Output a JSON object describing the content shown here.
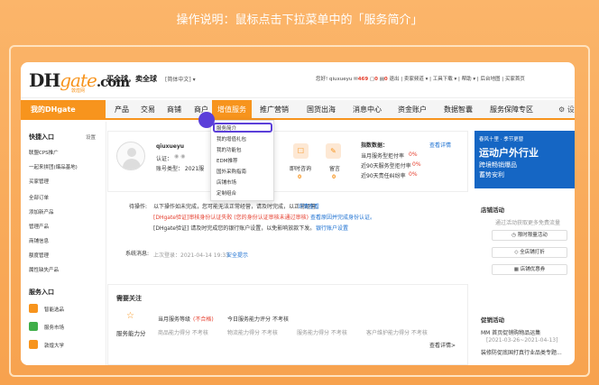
{
  "instruction": "操作说明：鼠标点击下拉菜单中的「服务简介」",
  "header": {
    "logo_dh": "DH",
    "logo_g": "gate",
    ".com": "",
    "logo_com": ".com",
    "logo_sub": "敦煌网",
    "slogan": "买全球，卖全球",
    "lang": "[简体中文] ▾",
    "hello": "您好! qiuxueyu",
    "msg_count": "469",
    "msg2": "0",
    "msg3": "0",
    "links": [
      "退出",
      "卖家频道 ▾",
      "工具下载 ▾",
      "帮助 ▾",
      "后台地图",
      "买家首页"
    ]
  },
  "nav": {
    "mine": "我的DHgate",
    "items": [
      "产品",
      "交易",
      "商铺",
      "商户",
      "增值服务",
      "推广营销",
      "国货出海",
      "消息中心",
      "资金账户",
      "数据智囊",
      "服务保障专区"
    ],
    "gear": "⚙ 设"
  },
  "sidebar": {
    "quick_title": "快捷入口",
    "set": "设置",
    "quick_items": [
      "联盟CPS推广",
      "一起来拼团(爆品基地)",
      "买家管理",
      "全部订单",
      "添加新产品",
      "管理产品",
      "商铺信息",
      "额度管理",
      "属性缺失产品"
    ],
    "service_title": "服务入口",
    "service_items": [
      "智能选品",
      "服务市场",
      "敦煌大学"
    ]
  },
  "dropdown": [
    "服务简介",
    "我的增值礼包",
    "我的功能包",
    "EDM推荐",
    "国外采购指南",
    "店铺市场",
    "定制组合"
  ],
  "profile": {
    "name": "qiuxueyu",
    "auth": "认证：",
    "acct": "账号类型：  2021服",
    "stats": [
      {
        "label": "即时咨询",
        "value": "0"
      },
      {
        "label": "留言",
        "value": "0"
      }
    ]
  },
  "indicators": {
    "title": "指数数据：",
    "more": "查看详情",
    "rows": [
      {
        "label": "当月服务型拒付率",
        "value": "0%"
      },
      {
        "label": "近90天服务型拒付率",
        "value": "0%"
      },
      {
        "label": "近90天责任纠纷率",
        "value": "0%"
      }
    ]
  },
  "tasks": {
    "label": "待操作:",
    "line1": "以下操作如未完成，您可能无法正常经营，请及时完成，以正常经营,",
    "line1_link": "详情查看",
    "line2": "[DHgate验证]审核身份认证失败 (您的身份认证审核未通过审核)",
    "line2_link": "查看原因并完成身份认证。",
    "line3": "[DHgate验证] 请及时完成您的银行账户设置，以免影响放款下发。",
    "line3_link": "银行账户设置"
  },
  "system": {
    "label": "系统消息:",
    "text": "上次登录：2021-04-14 19:33",
    "link": "安全提示"
  },
  "focus": {
    "title": "需要关注",
    "row1": {
      "a": "当月服务等级",
      "b": "(不合格)",
      "c": "今日服务能力评分",
      "d": "不考核"
    },
    "label": "服务能力分",
    "row2": [
      "商品能力得分  不考核",
      "物流能力得分  不考核",
      "服务能力得分  不考核",
      "客户维护能力得分  不考核"
    ],
    "more": "查看详情>"
  },
  "banner": {
    "top": "春风十里 · 季节更替",
    "title": "运动户外行业",
    "sub1": "跨境畅销爆品",
    "sub2": "蓄势安利"
  },
  "shop": {
    "title": "店铺活动",
    "desc": "通过活动获取更多免费流量",
    "buttons": [
      "限时限量活动",
      "全店铺打折",
      "店铺优惠券"
    ]
  },
  "promo": {
    "title": "促销活动",
    "items": [
      "MM 首页促销购物品运集",
      "[2021-03-26~2021-04-13]",
      "装修防促底国打真行业品类专题..."
    ]
  },
  "colors": {
    "accent": "#f7941d",
    "cursor": "#5b3fd9",
    "banner": "#1566c4"
  }
}
